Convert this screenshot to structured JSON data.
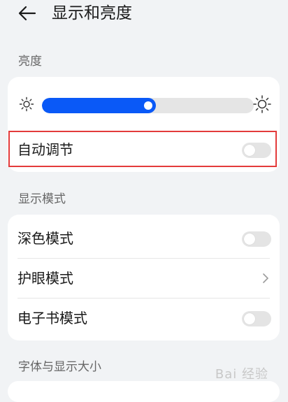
{
  "header": {
    "title": "显示和亮度",
    "back_icon": "back-arrow-icon"
  },
  "brightness": {
    "section_label": "亮度",
    "level_fraction": 0.5,
    "min_icon": "sun-small-icon",
    "max_icon": "sun-large-icon",
    "auto_adjust_label": "自动调节",
    "auto_adjust_on": false
  },
  "display_mode": {
    "section_label": "显示模式",
    "items": [
      {
        "label": "深色模式",
        "control": "toggle",
        "on": false
      },
      {
        "label": "护眼模式",
        "control": "chevron"
      },
      {
        "label": "电子书模式",
        "control": "toggle",
        "on": false
      }
    ]
  },
  "font_section": {
    "section_label": "字体与显示大小"
  },
  "watermark": "Bai 经验",
  "colors": {
    "accent": "#0a59f7",
    "highlight": "#e33b3b",
    "background": "#f1f3f5"
  }
}
